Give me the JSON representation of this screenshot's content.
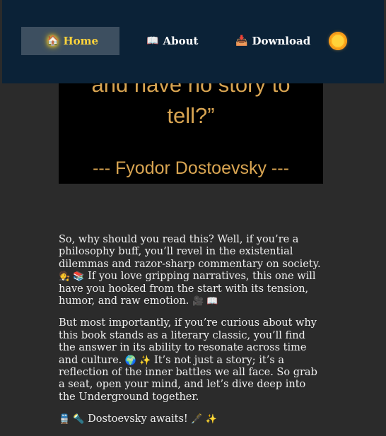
{
  "nav": {
    "home": {
      "icon": "🏠",
      "label": "Home"
    },
    "about": {
      "icon": "📖",
      "label": "About"
    },
    "download": {
      "icon": "📥",
      "label": "Download"
    },
    "theme_icon": "sun-icon"
  },
  "quote": {
    "line1": "and have no story to",
    "line2": "tell?”",
    "author": "--- Fyodor Dostoevsky ---"
  },
  "article": {
    "p1_text1": "So, why should you read this? Well, if you’re a philosophy buff, you’ll revel in the existential dilemmas and razor-sharp commentary on society.",
    "p1_emoji1": "🧑‍⚖️ 📚",
    "p1_text2": "If you love gripping narratives, this one will have you hooked from the start with its tension, humor, and raw emotion.",
    "p1_emoji2": "🎥 📖",
    "p2_text1": "But most importantly, if you’re curious about why this book stands as a literary classic, you’ll find the answer in its ability to resonate across time and culture.",
    "p2_emoji1": "🌍 ✨",
    "p2_text2": "It’s not just a story; it’s a reflection of the inner battles we all face. So grab a seat, open your mind, and let’s dive deep into the Underground together.",
    "p3_emoji1": "🚆 🔦",
    "p3_text1": "Dostoevsky awaits!",
    "p3_emoji2": "🖋️ ✨"
  },
  "colors": {
    "navbar_bg": "#0b2237",
    "active_bg": "#3d4f60",
    "active_text": "#ffd43b",
    "page_bg": "#2b2b2b",
    "quote_text": "#d9a552"
  }
}
